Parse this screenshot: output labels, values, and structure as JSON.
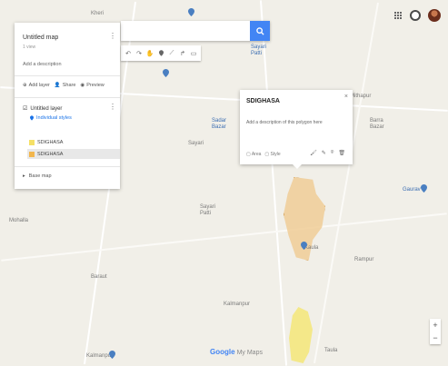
{
  "search": {
    "value": "",
    "placeholder": ""
  },
  "toolbar": {
    "tools": [
      "undo",
      "redo",
      "hand",
      "marker",
      "line",
      "route",
      "ruler"
    ]
  },
  "panel": {
    "title": "Untitled map",
    "subtitle": "1 view",
    "description": "Add a description",
    "actions": {
      "add_layer": "Add layer",
      "share": "Share",
      "preview": "Preview"
    },
    "layer": {
      "name": "Untitled layer",
      "style": "Individual styles",
      "items": [
        {
          "label": "SDIGHASA",
          "color": "#f5e066",
          "selected": false
        },
        {
          "label": "SDIGHASA",
          "color": "#f2b64d",
          "selected": true
        }
      ]
    },
    "basemap": "Base map"
  },
  "card": {
    "title": "SDIGHASA",
    "description": "Add a description of this polygon here",
    "footer": [
      "Area",
      "Style"
    ],
    "icons": [
      "paint-icon",
      "edit-icon",
      "camera-icon",
      "delete-icon"
    ]
  },
  "map": {
    "polygon_colors": {
      "main": "#f0cd96",
      "south": "#f5e678"
    },
    "places": [
      {
        "t": "Sayari\nPatti"
      },
      {
        "t": "Kheri"
      },
      {
        "t": "Sadar\nBazar"
      },
      {
        "t": "Sayari"
      },
      {
        "t": "Mithapur"
      },
      {
        "t": "Barra\nBazar"
      },
      {
        "t": "Gaurav"
      },
      {
        "t": "Sayari\nPatti"
      },
      {
        "t": "Mohalla"
      },
      {
        "t": "Kaula"
      },
      {
        "t": "Rampur"
      },
      {
        "t": "Baraut"
      },
      {
        "t": "Kalmanpur"
      },
      {
        "t": "Kalmanpur"
      },
      {
        "t": "Taula"
      }
    ]
  },
  "attribution": {
    "brand": "Google",
    "product": "My Maps"
  },
  "zoom": {
    "in": "+",
    "out": "−"
  }
}
